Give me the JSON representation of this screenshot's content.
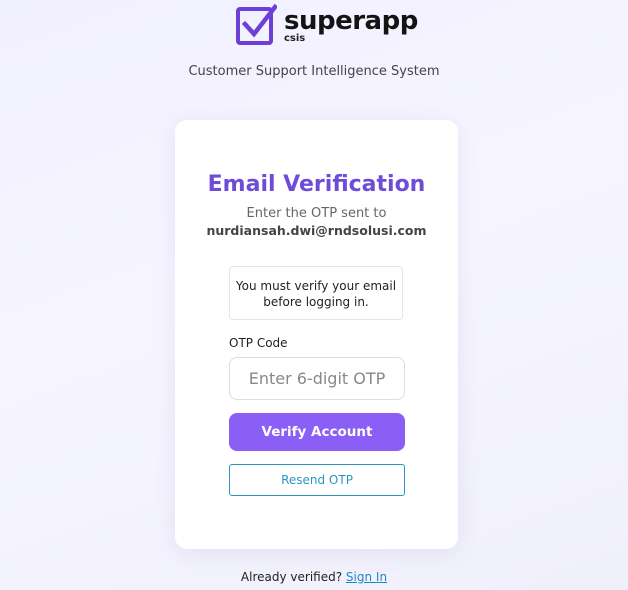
{
  "brand": {
    "name": "superapp",
    "sub": "csis",
    "logo_icon": "checkbox-check-icon",
    "accent_color": "#6e3fd6"
  },
  "system_name": "Customer Support Intelligence System",
  "card": {
    "title": "Email Verification",
    "otp_sent_text": "Enter the OTP sent to",
    "email": "nurdiansah.dwi@rndsolusi.com",
    "notice_line1": "You must verify your email",
    "notice_line2": "before logging in.",
    "otp_label": "OTP Code",
    "otp_placeholder": "Enter 6-digit OTP",
    "otp_value": "",
    "verify_button": "Verify Account",
    "resend_button": "Resend OTP"
  },
  "footer": {
    "prompt": "Already verified?",
    "signin_link": "Sign In"
  },
  "colors": {
    "title": "#6e4cd8",
    "primary_button": "#8b5ef5",
    "outline_button": "#2a96bf",
    "link": "#1e88c7"
  }
}
